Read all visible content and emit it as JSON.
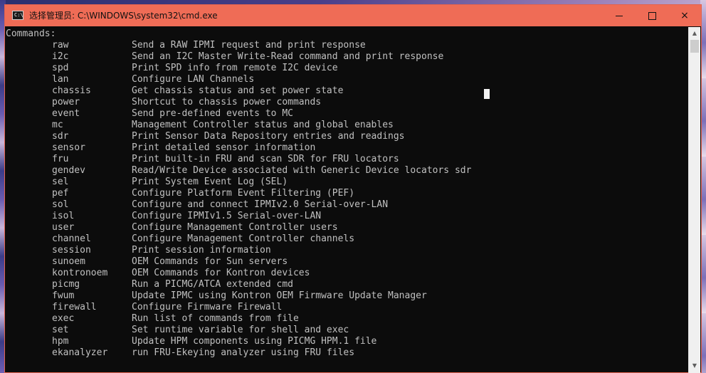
{
  "window": {
    "title": "选择管理员: C:\\WINDOWS\\system32\\cmd.exe",
    "icon": "cmd-console-icon",
    "icon_glyph": "C:\\",
    "titlebar_color": "#ef6c56",
    "controls": {
      "minimize": "minimize-icon",
      "maximize": "maximize-icon",
      "close": "×"
    }
  },
  "console": {
    "header": "Commands:",
    "foreground": "#c0c0c0",
    "background": "#0c0c0c",
    "commands": [
      {
        "name": "raw",
        "desc": "Send a RAW IPMI request and print response"
      },
      {
        "name": "i2c",
        "desc": "Send an I2C Master Write-Read command and print response"
      },
      {
        "name": "spd",
        "desc": "Print SPD info from remote I2C device"
      },
      {
        "name": "lan",
        "desc": "Configure LAN Channels"
      },
      {
        "name": "chassis",
        "desc": "Get chassis status and set power state"
      },
      {
        "name": "power",
        "desc": "Shortcut to chassis power commands"
      },
      {
        "name": "event",
        "desc": "Send pre-defined events to MC"
      },
      {
        "name": "mc",
        "desc": "Management Controller status and global enables"
      },
      {
        "name": "sdr",
        "desc": "Print Sensor Data Repository entries and readings"
      },
      {
        "name": "sensor",
        "desc": "Print detailed sensor information"
      },
      {
        "name": "fru",
        "desc": "Print built-in FRU and scan SDR for FRU locators"
      },
      {
        "name": "gendev",
        "desc": "Read/Write Device associated with Generic Device locators sdr"
      },
      {
        "name": "sel",
        "desc": "Print System Event Log (SEL)"
      },
      {
        "name": "pef",
        "desc": "Configure Platform Event Filtering (PEF)"
      },
      {
        "name": "sol",
        "desc": "Configure and connect IPMIv2.0 Serial-over-LAN"
      },
      {
        "name": "isol",
        "desc": "Configure IPMIv1.5 Serial-over-LAN"
      },
      {
        "name": "user",
        "desc": "Configure Management Controller users"
      },
      {
        "name": "channel",
        "desc": "Configure Management Controller channels"
      },
      {
        "name": "session",
        "desc": "Print session information"
      },
      {
        "name": "sunoem",
        "desc": "OEM Commands for Sun servers"
      },
      {
        "name": "kontronoem",
        "desc": "OEM Commands for Kontron devices"
      },
      {
        "name": "picmg",
        "desc": "Run a PICMG/ATCA extended cmd"
      },
      {
        "name": "fwum",
        "desc": "Update IPMC using Kontron OEM Firmware Update Manager"
      },
      {
        "name": "firewall",
        "desc": "Configure Firmware Firewall"
      },
      {
        "name": "exec",
        "desc": "Run list of commands from file"
      },
      {
        "name": "set",
        "desc": "Set runtime variable for shell and exec"
      },
      {
        "name": "hpm",
        "desc": "Update HPM components using PICMG HPM.1 file"
      },
      {
        "name": "ekanalyzer",
        "desc": "run FRU-Ekeying analyzer using FRU files"
      }
    ]
  },
  "scrollbar": {
    "up_arrow": "▲",
    "down_arrow": "▼"
  }
}
